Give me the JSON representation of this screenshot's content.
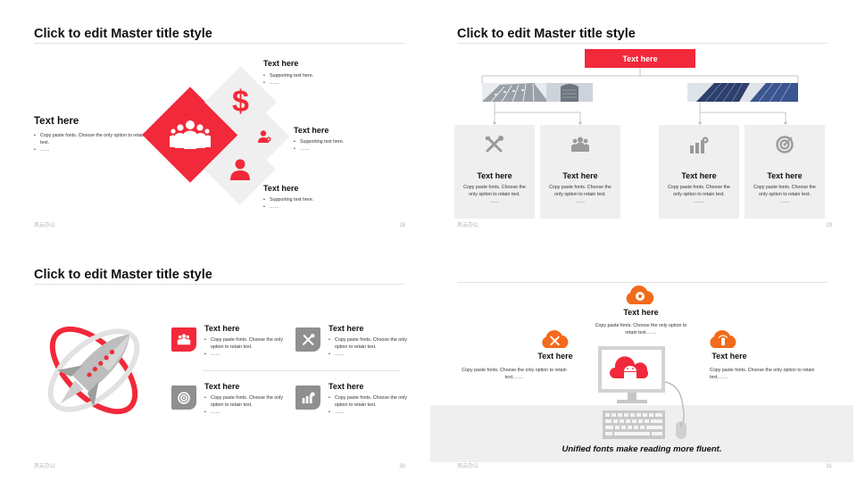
{
  "colors": {
    "accent": "#f2293a",
    "grey": "#8f8f8f",
    "light_grey": "#efefef",
    "orange": "#f26a1b"
  },
  "slide1": {
    "title": "Click to edit Master title style",
    "footer": "风云办公",
    "page": "28",
    "main": {
      "heading": "Text here",
      "bullets": [
        "Copy paste fonts. Choose the only option to retain text.",
        "……"
      ]
    },
    "items": [
      {
        "heading": "Text here",
        "bullets": [
          "Supporting text here.",
          "……"
        ],
        "icon": "dollar-icon"
      },
      {
        "heading": "Text here",
        "bullets": [
          "Supporting text here.",
          "……"
        ],
        "icon": "user-gear-icon"
      },
      {
        "heading": "Text here",
        "bullets": [
          "Supporting text here.",
          "……"
        ],
        "icon": "user-icon"
      }
    ],
    "center_icon": "team-icon"
  },
  "slide2": {
    "title": "Click to edit Master title style",
    "top_box": "Text here",
    "footer": "风云办公",
    "page": "29",
    "cards": [
      {
        "heading": "Text here",
        "text": "Copy paste fonts. Choose the only option to retain text.",
        "more": "……",
        "icon": "tools-icon"
      },
      {
        "heading": "Text here",
        "text": "Copy paste fonts. Choose the only option to retain text.",
        "more": "……",
        "icon": "team-icon"
      },
      {
        "heading": "Text here",
        "text": "Copy paste fonts. Choose the only option to retain text.",
        "more": "……",
        "icon": "chart-gear-icon"
      },
      {
        "heading": "Text here",
        "text": "Copy paste fonts. Choose the only option to retain text.",
        "more": "……",
        "icon": "target-icon"
      }
    ]
  },
  "slide3": {
    "title": "Click to edit Master title style",
    "footer": "风云办公",
    "page": "30",
    "hero_icon": "rocket-icon",
    "items": [
      {
        "heading": "Text here",
        "bullets": [
          "Copy paste fonts. Choose the only option to retain text.",
          "……"
        ],
        "icon": "team-icon"
      },
      {
        "heading": "Text here",
        "bullets": [
          "Copy paste fonts. Choose the only option to retain text.",
          "……"
        ],
        "icon": "tools-icon"
      },
      {
        "heading": "Text here",
        "bullets": [
          "Copy paste fonts. Choose the only option to retain text.",
          "……"
        ],
        "icon": "target-icon"
      },
      {
        "heading": "Text here",
        "bullets": [
          "Copy paste fonts. Choose the only option to retain text.",
          "……"
        ],
        "icon": "chart-gear-icon"
      }
    ]
  },
  "slide4": {
    "footer": "风云办公",
    "page": "31",
    "top": {
      "heading": "Text here",
      "text": "Copy paste fonts. Choose the only option to retain text.……",
      "icon": "cloud-gear-icon"
    },
    "left": {
      "heading": "Text here",
      "text": "Copy paste fonts. Choose the only option to retain text.……",
      "icon": "cloud-tools-icon"
    },
    "right": {
      "heading": "Text here",
      "text": "Copy paste fonts. Choose the only option to retain text.……",
      "icon": "cloud-signal-icon"
    },
    "monitor_icon": "cloud-android-icon",
    "caption": "Unified fonts make reading more fluent."
  }
}
